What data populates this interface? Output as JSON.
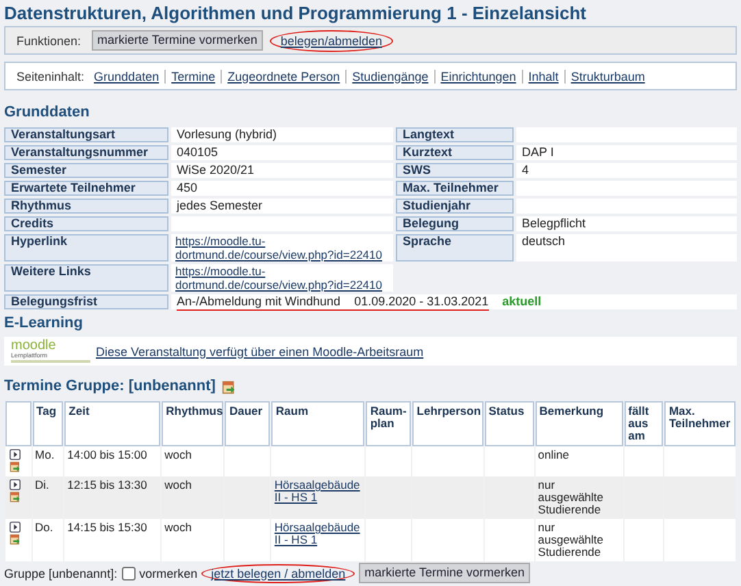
{
  "title": "Datenstrukturen, Algorithmen und Programmierung 1 - Einzelansicht",
  "functions": {
    "label": "Funktionen:",
    "items": [
      {
        "kind": "button",
        "label": "markierte Termine vormerken"
      },
      {
        "kind": "link",
        "label": "belegen/abmelden",
        "circled": true
      }
    ]
  },
  "page_contents": {
    "label": "Seiteninhalt:",
    "links": [
      "Grunddaten",
      "Termine",
      "Zugeordnete Person",
      "Studiengänge",
      "Einrichtungen",
      "Inhalt",
      "Strukturbaum"
    ]
  },
  "basic_data": {
    "heading": "Grunddaten",
    "rows": [
      {
        "label": "Veranstaltungsart",
        "value": "Vorlesung (hybrid)",
        "label2": "Langtext",
        "value2": ""
      },
      {
        "label": "Veranstaltungsnummer",
        "value": "040105",
        "label2": "Kurztext",
        "value2": "DAP I"
      },
      {
        "label": "Semester",
        "value": "WiSe 2020/21",
        "label2": "SWS",
        "value2": "4"
      },
      {
        "label": "Erwartete Teilnehmer",
        "value": "450",
        "label2": "Max. Teilnehmer",
        "value2": ""
      },
      {
        "label": "Rhythmus",
        "value": "jedes Semester",
        "label2": "Studienjahr",
        "value2": ""
      },
      {
        "label": "Credits",
        "value": "",
        "label2": "Belegung",
        "value2": "Belegpflicht"
      },
      {
        "label": "Hyperlink",
        "kind": "link",
        "value": "https://moodle.tu-dortmund.de/course/view.php?id=22410",
        "label2": "Sprache",
        "value2": "deutsch"
      },
      {
        "label": "Weitere Links",
        "kind": "link",
        "value": "https://moodle.tu-dortmund.de/course/view.php?id=22410"
      }
    ],
    "deadline": {
      "label": "Belegungsfrist",
      "value": "An-/Abmeldung mit Windhund    01.09.2020 - 31.03.2021",
      "status": "aktuell",
      "underlined": true
    }
  },
  "elearning": {
    "heading": "E-Learning",
    "logo_text": "moodle",
    "logo_sub": "Lernplattform",
    "link": "Diese Veranstaltung verfügt über einen Moodle-Arbeitsraum"
  },
  "dates": {
    "heading": "Termine Gruppe: [unbenannt]",
    "columns": [
      "Tag",
      "Zeit",
      "Rhythmus",
      "Dauer",
      "Raum",
      "Raum-plan",
      "Lehrperson",
      "Status",
      "Bemerkung",
      "fällt aus am",
      "Max. Teilnehmer"
    ],
    "rows": [
      {
        "cells": [
          "Mo.",
          "14:00 bis 15:00",
          "woch",
          "",
          "",
          "",
          "",
          "",
          "online",
          "",
          ""
        ]
      },
      {
        "cells": [
          "Di.",
          "12:15 bis 13:30",
          "woch",
          "",
          "Hörsaalgebäude II - HS 1",
          "",
          "",
          "",
          "nur ausgewählte Studierende",
          "",
          ""
        ]
      },
      {
        "cells": [
          "Do.",
          "14:15 bis 15:30",
          "woch",
          "",
          "Hörsaalgebäude II - HS 1",
          "",
          "",
          "",
          "nur ausgewählte Studierende",
          "",
          ""
        ]
      }
    ],
    "footer": {
      "group_label": "Gruppe [unbenannt]:",
      "checkbox_label": "vormerken",
      "checked": false,
      "link": "jetzt belegen / abmelden",
      "link_circled": true,
      "button": "markierte Termine vormerken"
    }
  }
}
